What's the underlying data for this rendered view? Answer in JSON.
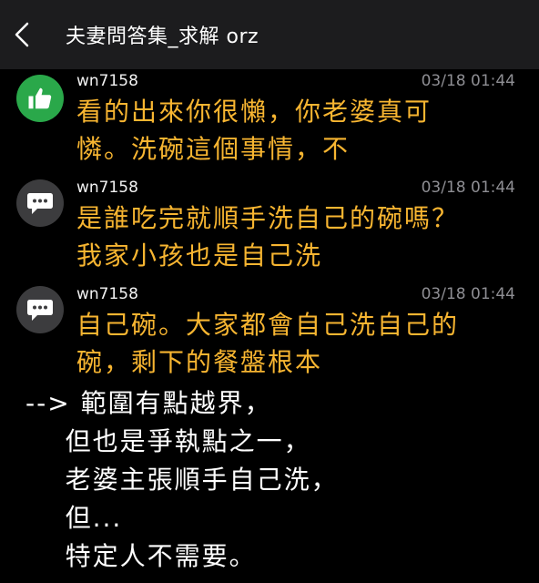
{
  "header": {
    "title": "夫妻問答集_求解 orz"
  },
  "comments": [
    {
      "avatar": "thumbs-up-icon",
      "user": "wn7158",
      "time": "03/18 01:44",
      "lines": [
        "看的出來你很懶，你老婆真可",
        "憐。洗碗這個事情，不"
      ]
    },
    {
      "avatar": "chat-bubble-icon",
      "user": "wn7158",
      "time": "03/18 01:44",
      "lines": [
        "是誰吃完就順手洗自己的碗嗎？",
        "我家小孩也是自己洗"
      ]
    },
    {
      "avatar": "chat-bubble-icon",
      "user": "wn7158",
      "time": "03/18 01:44",
      "lines": [
        "自己碗。大家都會自己洗自己的",
        "碗，剩下的餐盤根本"
      ]
    }
  ],
  "note": {
    "lines": [
      "--> 範圍有點越界，",
      "    但也是爭執點之一，",
      "    老婆主張順手自己洗，",
      "    但...",
      "    特定人不需要。"
    ]
  },
  "colors": {
    "comment_text": "#f7b531",
    "like_green": "#2aa84a",
    "bubble_gray": "#3c3c3e"
  }
}
